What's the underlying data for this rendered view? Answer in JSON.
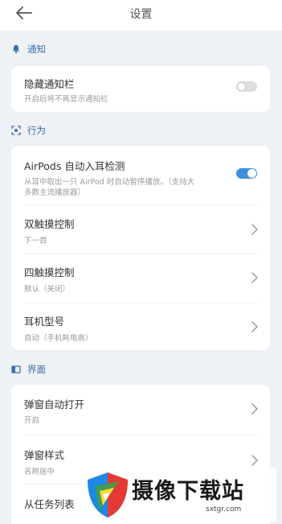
{
  "header": {
    "title": "设置",
    "back_icon": "arrow-left-icon"
  },
  "colors": {
    "accent": "#3d8fd9",
    "section": "#3d6fa8",
    "background": "#eef1f5"
  },
  "sections": [
    {
      "label": "通知",
      "icon": "bell-icon",
      "items": [
        {
          "title": "隐藏通知栏",
          "subtitle": "开启后将不再显示通知栏",
          "control": "toggle",
          "enabled": false
        }
      ]
    },
    {
      "label": "行为",
      "icon": "scan-icon",
      "items": [
        {
          "title": "AirPods 自动入耳检测",
          "subtitle_line1": "从耳中取出一只 AirPod 时自动暂停播放。（支持大",
          "subtitle_line2": "多数主流播放器）",
          "control": "toggle",
          "enabled": true
        },
        {
          "title": "双触摸控制",
          "subtitle": "下一首",
          "control": "chevron"
        },
        {
          "title": "四触摸控制",
          "subtitle": "默认（关闭）",
          "control": "chevron"
        },
        {
          "title": "耳机型号",
          "subtitle": "自动（手机耗电高）",
          "control": "chevron"
        }
      ]
    },
    {
      "label": "界面",
      "icon": "window-icon",
      "items": [
        {
          "title": "弹窗自动打开",
          "subtitle": "开启",
          "control": "chevron"
        },
        {
          "title": "弹窗样式",
          "subtitle": "名称居中",
          "control": "chevron"
        },
        {
          "title": "从任务列表",
          "subtitle": "",
          "control": "chevron"
        }
      ]
    }
  ],
  "watermark": {
    "text": "摄像下载站",
    "url": "sxtgr.com"
  }
}
